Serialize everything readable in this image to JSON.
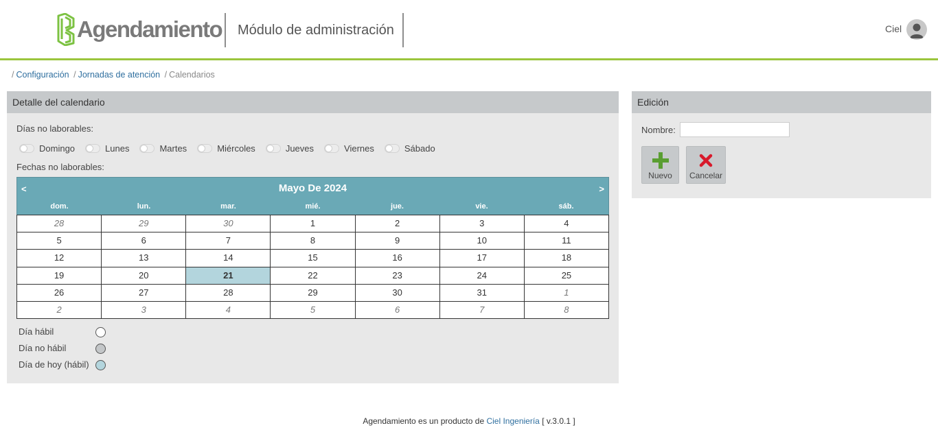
{
  "header": {
    "logo_text": "Agendamiento",
    "module_title": "Módulo de administración",
    "user_name": "Ciel",
    "accent_color": "#9bc53d"
  },
  "breadcrumb": {
    "items": [
      "Configuración",
      "Jornadas de atención",
      "Calendarios"
    ]
  },
  "left_panel": {
    "title": "Detalle del calendario",
    "non_working_days_label": "Días no laborables:",
    "days": [
      {
        "label": "Domingo",
        "checked": false
      },
      {
        "label": "Lunes",
        "checked": false
      },
      {
        "label": "Martes",
        "checked": false
      },
      {
        "label": "Miércoles",
        "checked": false
      },
      {
        "label": "Jueves",
        "checked": false
      },
      {
        "label": "Viernes",
        "checked": false
      },
      {
        "label": "Sábado",
        "checked": false
      }
    ],
    "non_working_dates_label": "Fechas no laborables:",
    "calendar": {
      "prev": "<",
      "next": ">",
      "title": "Mayo De 2024",
      "weekdays": [
        "dom.",
        "lun.",
        "mar.",
        "mié.",
        "jue.",
        "vie.",
        "sáb."
      ],
      "header_color": "#6aa9b6",
      "today_color": "#b3d5dd",
      "weeks": [
        [
          "28",
          "29",
          "30",
          "1",
          "2",
          "3",
          "4"
        ],
        [
          "5",
          "6",
          "7",
          "8",
          "9",
          "10",
          "11"
        ],
        [
          "12",
          "13",
          "14",
          "15",
          "16",
          "17",
          "18"
        ],
        [
          "19",
          "20",
          "21",
          "22",
          "23",
          "24",
          "25"
        ],
        [
          "26",
          "27",
          "28",
          "29",
          "30",
          "31",
          "1"
        ],
        [
          "2",
          "3",
          "4",
          "5",
          "6",
          "7",
          "8"
        ]
      ],
      "today": "21"
    },
    "legend": {
      "habil": "Día hábil",
      "no_habil": "Día no hábil",
      "hoy": "Día de hoy (hábil)"
    }
  },
  "right_panel": {
    "title": "Edición",
    "nombre_label": "Nombre:",
    "nombre_value": "",
    "nuevo_label": "Nuevo",
    "cancelar_label": "Cancelar"
  },
  "footer": {
    "text_before": "Agendamiento es un producto de ",
    "link": "Ciel Ingeniería",
    "text_after": " [ v.3.0.1 ]"
  }
}
